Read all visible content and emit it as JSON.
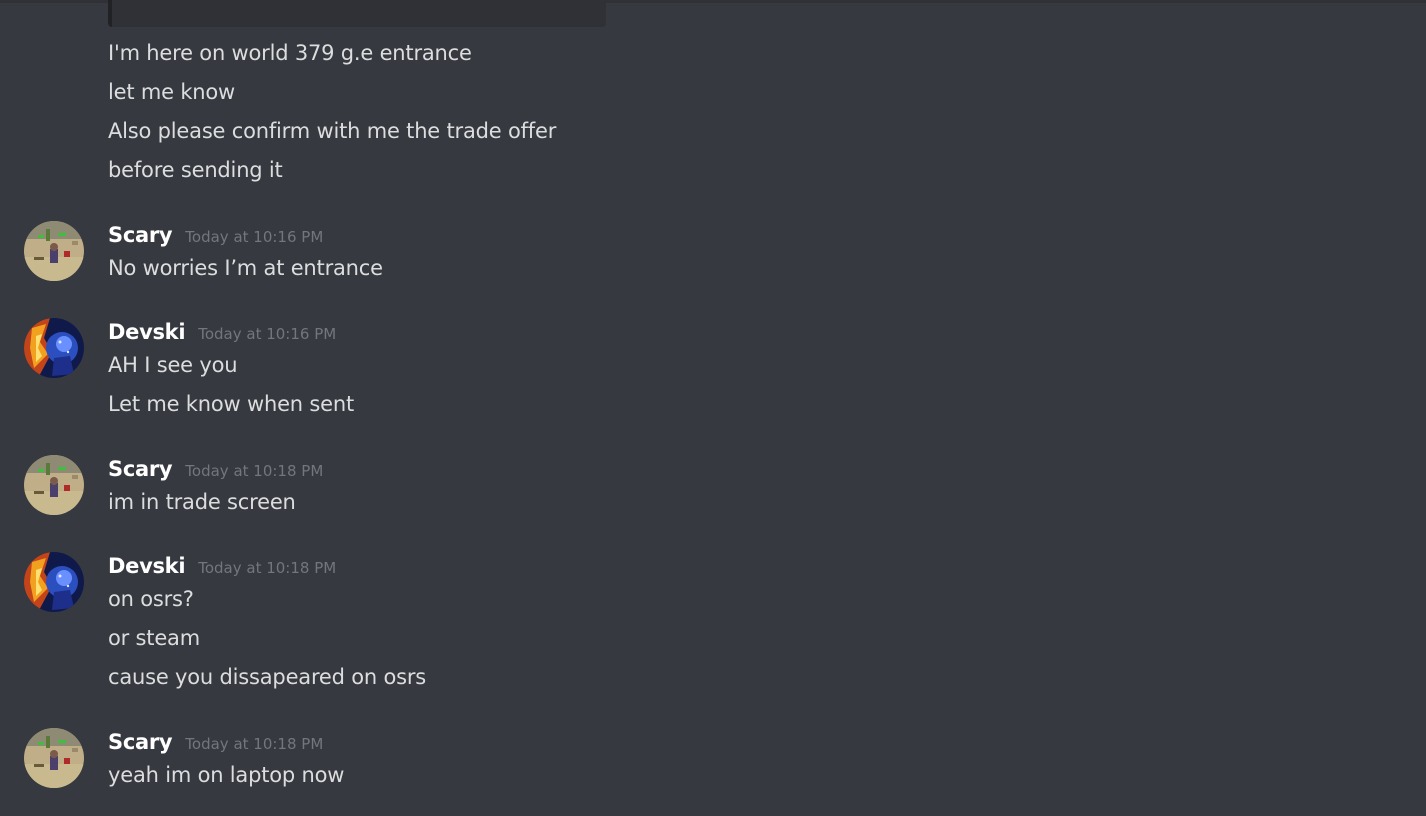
{
  "messages": [
    {
      "author": "",
      "timestamp": "",
      "lines": [
        "I'm here on world 379 g.e entrance",
        "let me know",
        "Also please confirm with me the trade offer",
        "before sending it"
      ]
    },
    {
      "author": "Scary",
      "timestamp": "Today at 10:16 PM",
      "avatar_icon": "scary-avatar",
      "lines": [
        "No worries I’m at entrance"
      ]
    },
    {
      "author": "Devski",
      "timestamp": "Today at 10:16 PM",
      "avatar_icon": "devski-avatar",
      "lines": [
        "AH I see you",
        "Let me know when sent"
      ]
    },
    {
      "author": "Scary",
      "timestamp": "Today at 10:18 PM",
      "avatar_icon": "scary-avatar",
      "lines": [
        "im in trade screen"
      ]
    },
    {
      "author": "Devski",
      "timestamp": "Today at 10:18 PM",
      "avatar_icon": "devski-avatar",
      "lines": [
        "on osrs?",
        "or steam",
        "cause you dissapeared on osrs"
      ]
    },
    {
      "author": "Scary",
      "timestamp": "Today at 10:18 PM",
      "avatar_icon": "scary-avatar",
      "lines": [
        "yeah im on laptop now"
      ]
    }
  ],
  "colors": {
    "background": "#36393f",
    "message_text": "#dcddde",
    "username": "#ffffff",
    "timestamp": "#72767d"
  }
}
